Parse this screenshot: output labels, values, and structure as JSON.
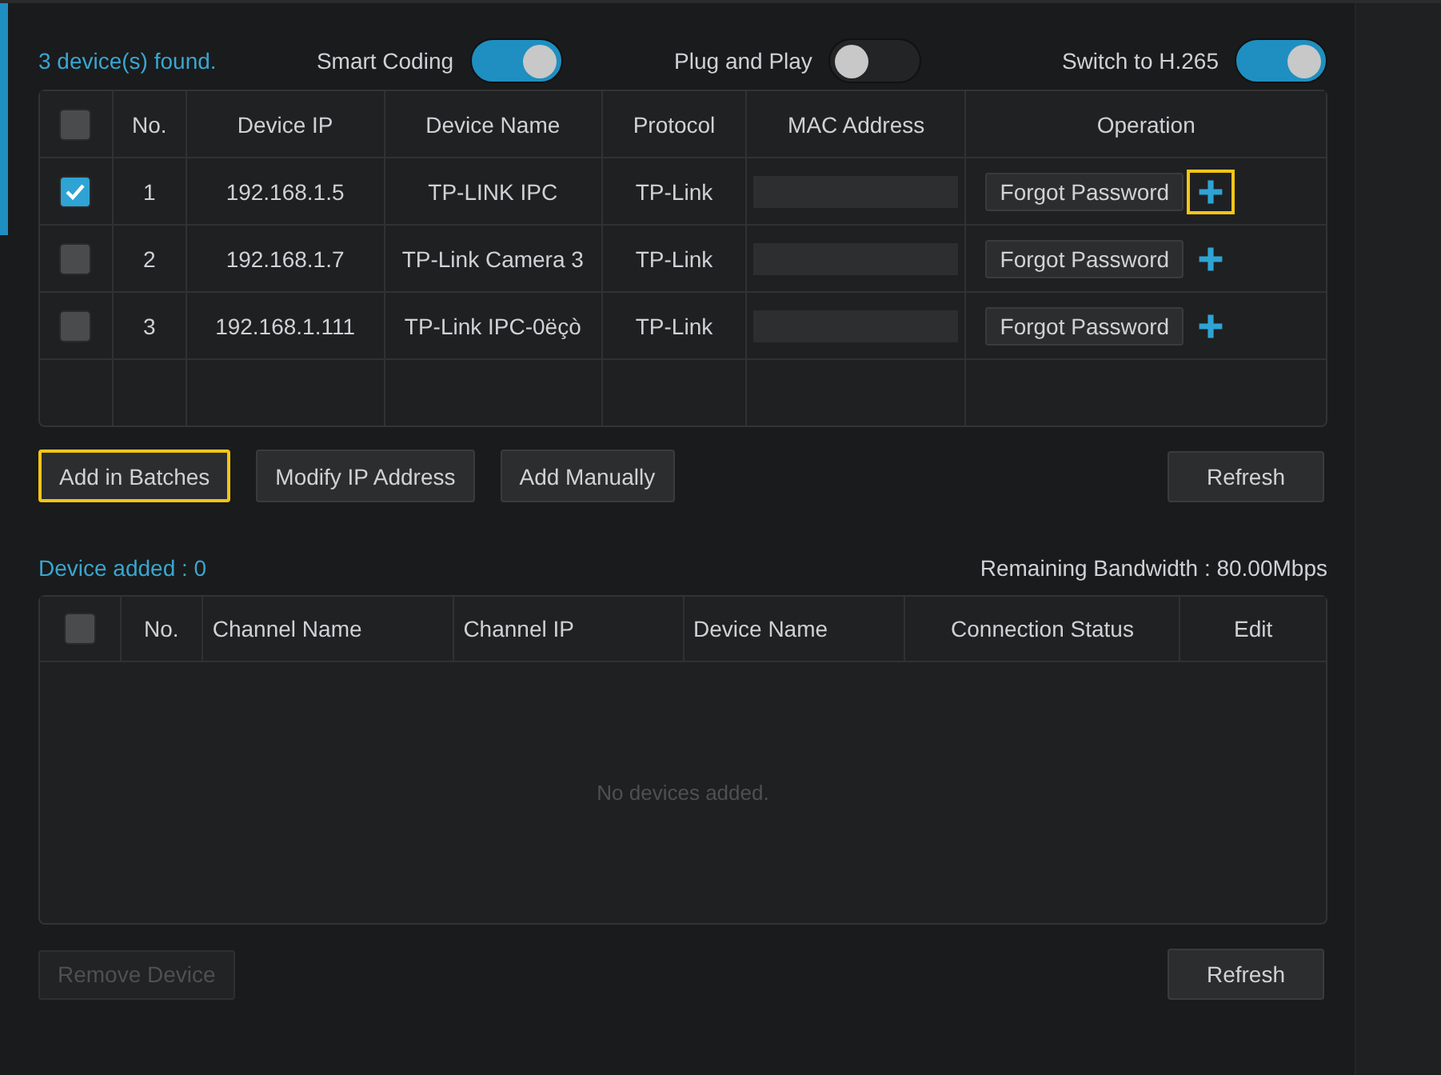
{
  "found_label": "3 device(s) found.",
  "toggles": [
    {
      "label": "Smart Coding",
      "on": true
    },
    {
      "label": "Plug and Play",
      "on": false
    },
    {
      "label": "Switch to H.265",
      "on": true
    }
  ],
  "found_table": {
    "columns": [
      "No.",
      "Device IP",
      "Device Name",
      "Protocol",
      "MAC Address",
      "Operation"
    ],
    "header_checked": false,
    "rows": [
      {
        "checked": true,
        "no": "1",
        "ip": "192.168.1.5",
        "name": "TP-LINK IPC",
        "protocol": "TP-Link",
        "action": "Forgot Password",
        "add_highlighted": true
      },
      {
        "checked": false,
        "no": "2",
        "ip": "192.168.1.7",
        "name": "TP-Link Camera 3",
        "protocol": "TP-Link",
        "action": "Forgot Password",
        "add_highlighted": false
      },
      {
        "checked": false,
        "no": "3",
        "ip": "192.168.1.111",
        "name": "TP-Link IPC-0ëçò",
        "protocol": "TP-Link",
        "action": "Forgot Password",
        "add_highlighted": false
      }
    ]
  },
  "actions": [
    {
      "label": "Add in Batches",
      "highlighted": true
    },
    {
      "label": "Modify IP Address",
      "highlighted": false
    },
    {
      "label": "Add Manually",
      "highlighted": false
    }
  ],
  "refresh_top": "Refresh",
  "added_label": "Device added : 0",
  "bandwidth": "Remaining Bandwidth : 80.00Mbps",
  "added_table": {
    "columns": [
      "No.",
      "Channel Name",
      "Channel IP",
      "Device Name",
      "Connection Status",
      "Edit"
    ],
    "header_checked": false,
    "empty_text": "No devices added."
  },
  "remove_button": {
    "label": "Remove Device",
    "disabled": true
  },
  "refresh_bottom": "Refresh"
}
